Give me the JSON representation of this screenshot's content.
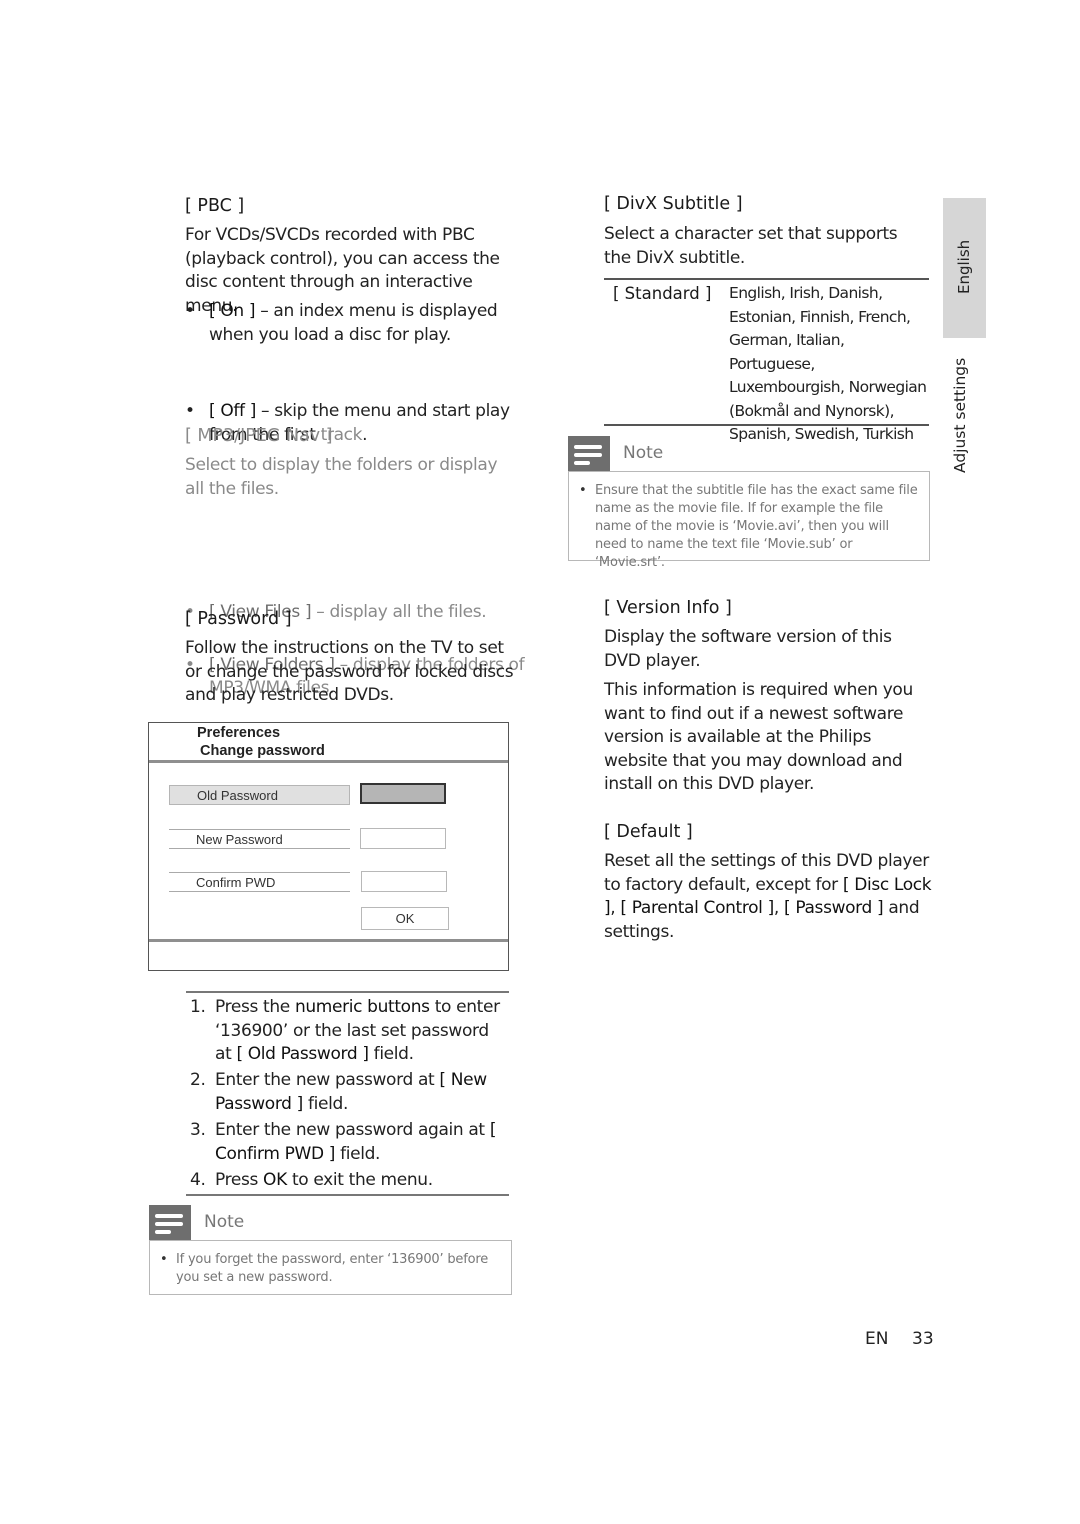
{
  "left_column": {
    "pbc": {
      "heading": "[ PBC ]",
      "description": "For VCDs/SVCDs recorded with PBC (playback control), you can access the disc content through an interactive menu.",
      "options": [
        {
          "label": "[ On ]",
          "text": " – an index menu is displayed when you load a disc for play."
        },
        {
          "label": "[ Off ]",
          "text": " – skip the menu and start play from the first ",
          "trailing": "track",
          "end": "."
        }
      ]
    },
    "mp3_jpeg_nav": {
      "heading": "[ MP3/JPEG Nav ]",
      "description": "Select to display the folders or display all the files.",
      "options": [
        {
          "label": "[ View Files ]",
          "text": " – display all the files."
        },
        {
          "label": "[ View Folders ]",
          "text": " – display the folders of MP3/WMA files."
        }
      ]
    },
    "password": {
      "heading": "[ Password ]",
      "description": "Follow the instructions on the TV to set or change the password for locked discs and play restricted DVDs."
    },
    "dialog": {
      "title_line1": "Preferences",
      "title_line2": "Change password",
      "fields": [
        {
          "label": "Old Password",
          "value": "",
          "selected": true
        },
        {
          "label": "New Password",
          "value": "",
          "selected": false
        },
        {
          "label": "Confirm PWD",
          "value": "",
          "selected": false
        }
      ],
      "ok_label": "OK"
    },
    "steps": [
      {
        "num": "1.",
        "parts": [
          "Press the ",
          "numeric buttons",
          " to enter ‘136900’ or the last set password at ",
          "[ Old Password ]",
          " field."
        ]
      },
      {
        "num": "2.",
        "parts": [
          "Enter the new password at ",
          "[ New Password ]",
          " field."
        ]
      },
      {
        "num": "3.",
        "parts": [
          "Enter the new password again at ",
          "[ Confirm PWD ]",
          " field."
        ]
      },
      {
        "num": "4.",
        "parts": [
          "Press ",
          "OK",
          " to exit the menu."
        ]
      }
    ],
    "note": {
      "title": "Note",
      "items": [
        "If you forget the password, enter ‘136900’ before you set a new password."
      ]
    }
  },
  "right_column": {
    "divx_subtitle": {
      "heading": "[ DivX Subtitle ]",
      "description": "Select a character set that supports the DivX subtitle.",
      "table": [
        {
          "option": "[ Standard ]",
          "languages": "English, Irish, Danish, Estonian, Finnish, French, German, Italian, Portuguese, Luxembourgish, Norwegian (Bokmål and Nynorsk), Spanish, Swedish, Turkish"
        }
      ]
    },
    "note": {
      "title": "Note",
      "items": [
        "Ensure that the subtitle file has the exact same file name as the movie file. If for example the file name of the movie is ‘Movie.avi’, then you will need to name the text file ‘Movie.sub’ or ‘Movie.srt’."
      ]
    },
    "version_info": {
      "heading": "[ Version Info ]",
      "description": "Display the software version of this DVD player.",
      "detail": "This information is required when you want to find out if a newest software version is available at the Philips website that you may download and install on this DVD player."
    },
    "default": {
      "heading": "[ Default ]",
      "parts": [
        "Reset all the settings of this DVD player to factory default, except for ",
        "[ Disc Lock ]",
        ", ",
        "[ Parental Control ]",
        ", ",
        "[ Password ]",
        " and settings."
      ]
    }
  },
  "side_tabs": {
    "language": "English",
    "section": "Adjust settings"
  },
  "footer": {
    "lang_code": "EN",
    "page_number": "33"
  }
}
